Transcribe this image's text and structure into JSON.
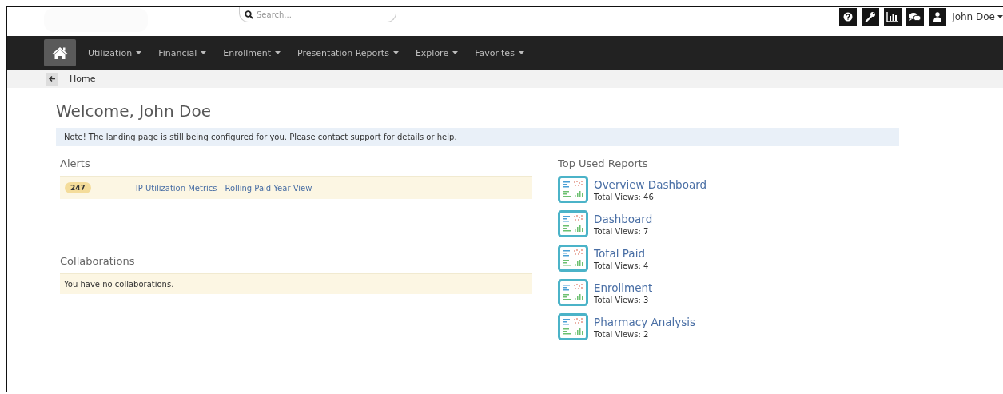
{
  "header": {
    "search": {
      "placeholder": "Search..."
    },
    "user": "John Doe"
  },
  "nav": {
    "items": [
      {
        "label": "Utilization"
      },
      {
        "label": "Financial"
      },
      {
        "label": "Enrollment"
      },
      {
        "label": "Presentation Reports"
      },
      {
        "label": "Explore"
      },
      {
        "label": "Favorites"
      }
    ]
  },
  "breadcrumb": "Home",
  "welcome": "Welcome, John Doe",
  "note": "Note! The landing page is still being configured for you. Please contact support for details or help.",
  "alerts": {
    "title": "Alerts",
    "items": [
      {
        "count": "247",
        "label": "IP Utilization Metrics - Rolling Paid Year View"
      }
    ]
  },
  "collaborations": {
    "title": "Collaborations",
    "empty": "You have no collaborations."
  },
  "top_reports": {
    "title": "Top Used Reports",
    "items": [
      {
        "name": "Overview Dashboard",
        "views": "Total Views: 46"
      },
      {
        "name": "Dashboard",
        "views": "Total Views: 7"
      },
      {
        "name": "Total Paid",
        "views": "Total Views: 4"
      },
      {
        "name": "Enrollment",
        "views": "Total Views: 3"
      },
      {
        "name": "Pharmacy Analysis",
        "views": "Total Views: 2"
      }
    ]
  }
}
